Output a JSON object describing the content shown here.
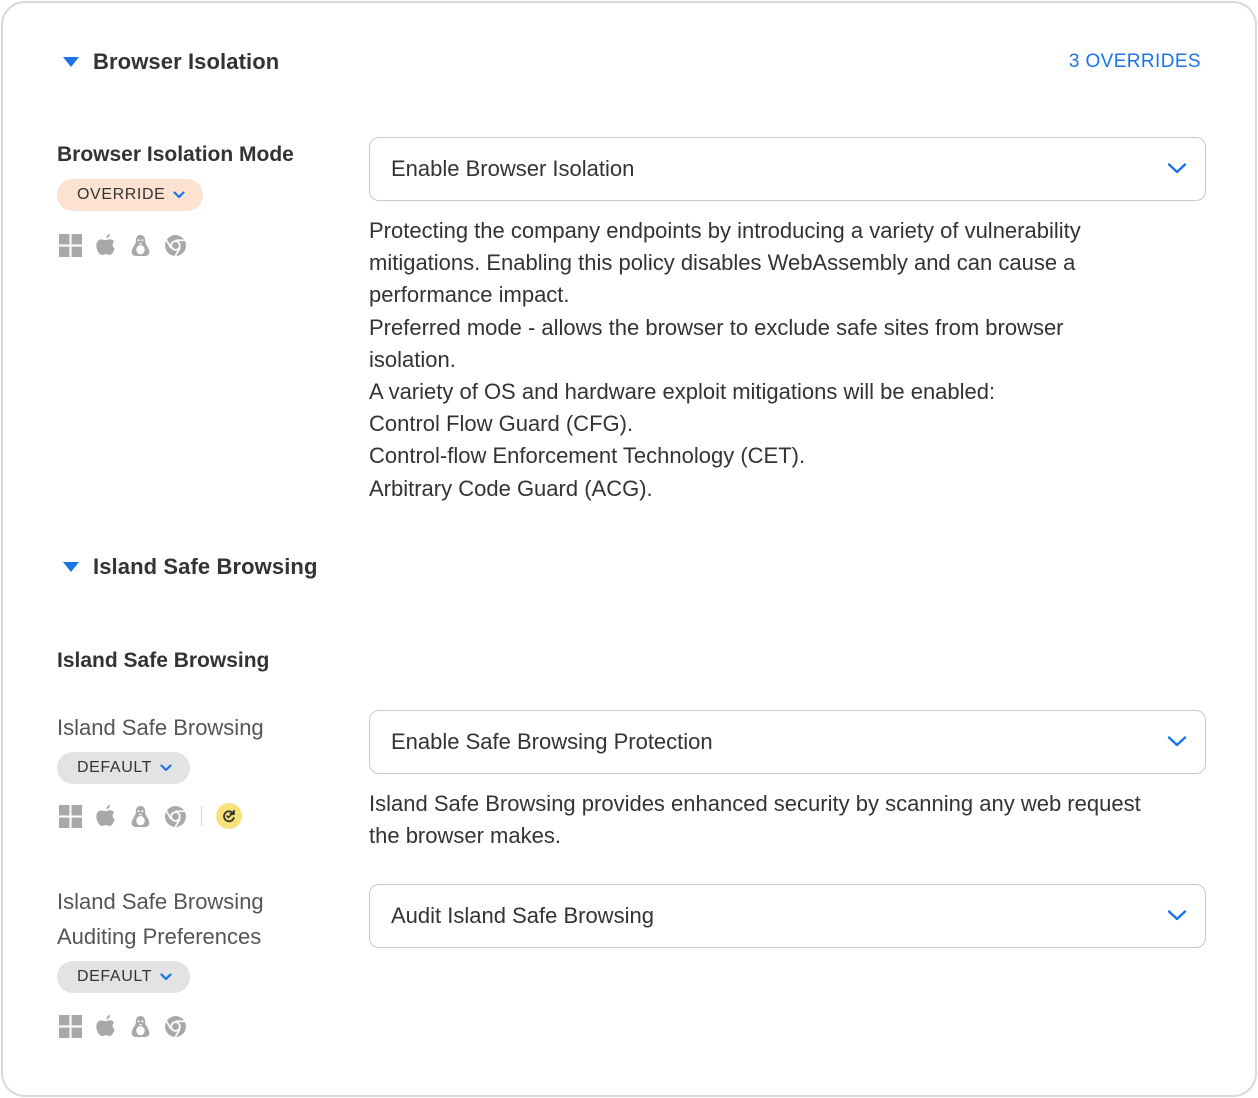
{
  "colors": {
    "accent": "#1a73e8",
    "override_pill": "#fde2d2",
    "default_pill": "#e3e3e3",
    "badge": "#f7e27a"
  },
  "browser_isolation": {
    "section_title": "Browser Isolation",
    "overrides_link": "3 OVERRIDES",
    "mode": {
      "label": "Browser Isolation Mode",
      "pill": "OVERRIDE",
      "platform_icons": [
        "windows-icon",
        "apple-icon",
        "linux-icon",
        "chrome-icon"
      ],
      "select_value": "Enable Browser Isolation",
      "description": [
        "Protecting the company endpoints by introducing a variety of vulnerability",
        "mitigations. Enabling this policy disables WebAssembly and can cause a",
        "performance impact.",
        "Preferred mode - allows the browser to exclude safe sites from browser",
        "isolation.",
        "A variety of OS and hardware exploit mitigations will be enabled:",
        "Control Flow Guard (CFG).",
        "Control-flow Enforcement Technology (CET).",
        "Arbitrary Code Guard (ACG)."
      ]
    }
  },
  "safe_browsing": {
    "section_title": "Island Safe Browsing",
    "group_title": "Island Safe Browsing",
    "setting1": {
      "label": "Island Safe Browsing",
      "pill": "DEFAULT",
      "platform_icons": [
        "windows-icon",
        "apple-icon",
        "linux-icon",
        "chrome-icon",
        "sync-badge-icon"
      ],
      "select_value": "Enable Safe Browsing Protection",
      "description": [
        "Island Safe Browsing provides enhanced security by scanning any web request",
        "the browser makes."
      ]
    },
    "setting2": {
      "label_line1": "Island Safe Browsing",
      "label_line2": "Auditing Preferences",
      "pill": "DEFAULT",
      "platform_icons": [
        "windows-icon",
        "apple-icon",
        "linux-icon",
        "chrome-icon"
      ],
      "select_value": "Audit Island Safe Browsing"
    }
  }
}
